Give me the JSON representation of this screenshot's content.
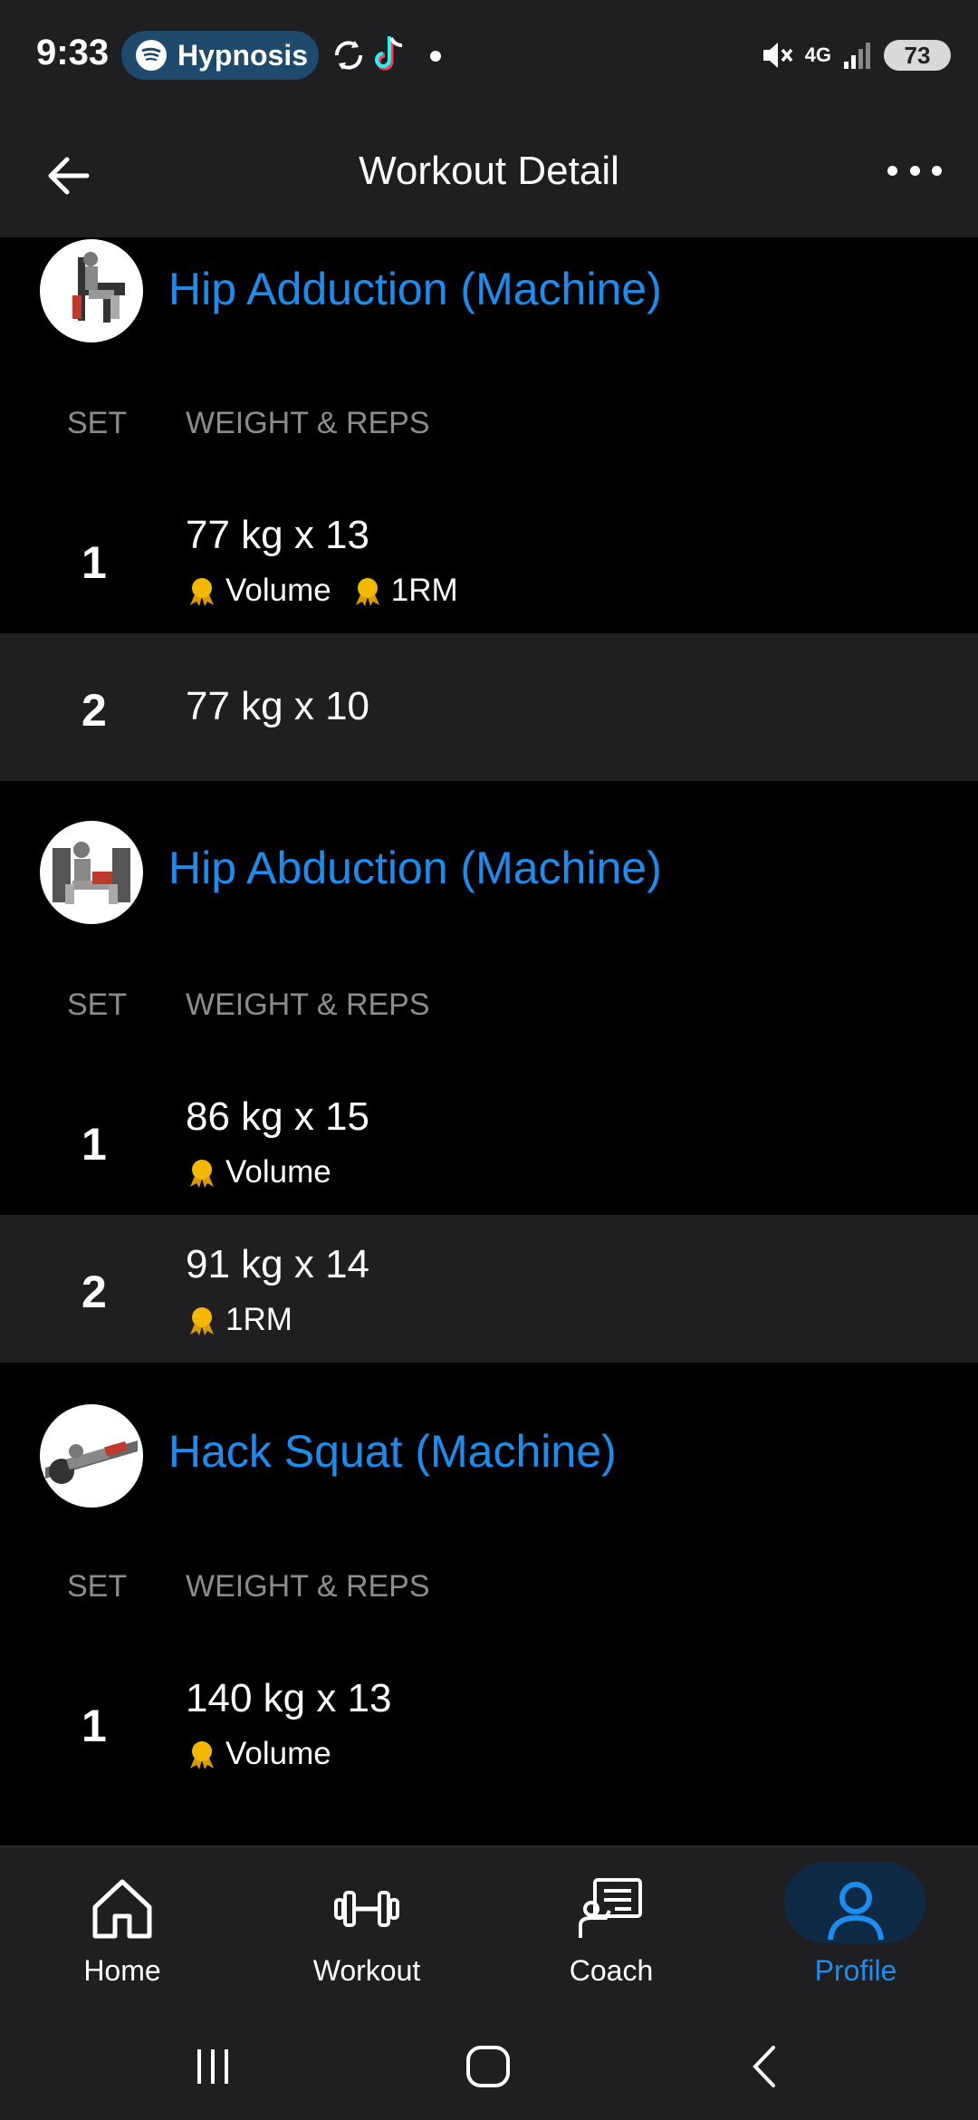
{
  "status_bar": {
    "time": "9:33",
    "media_label": "Hypnosis",
    "network": "4G",
    "battery": "73"
  },
  "header": {
    "title": "Workout Detail"
  },
  "columns": {
    "set": "SET",
    "weight_reps": "WEIGHT & REPS"
  },
  "exercises": [
    {
      "name": "Hip Adduction (Machine)",
      "sets": [
        {
          "num": "1",
          "value": "77 kg x 13",
          "records": [
            "Volume",
            "1RM"
          ]
        },
        {
          "num": "2",
          "value": "77 kg x 10",
          "records": []
        }
      ]
    },
    {
      "name": "Hip Abduction (Machine)",
      "sets": [
        {
          "num": "1",
          "value": "86 kg x 15",
          "records": [
            "Volume"
          ]
        },
        {
          "num": "2",
          "value": "91 kg x 14",
          "records": [
            "1RM"
          ]
        }
      ]
    },
    {
      "name": "Hack Squat (Machine)",
      "sets": [
        {
          "num": "1",
          "value": "140 kg x 13",
          "records": [
            "Volume"
          ]
        }
      ]
    }
  ],
  "bottom_nav": [
    {
      "label": "Home",
      "icon": "home-icon",
      "active": false
    },
    {
      "label": "Workout",
      "icon": "dumbbell-icon",
      "active": false
    },
    {
      "label": "Coach",
      "icon": "coach-icon",
      "active": false
    },
    {
      "label": "Profile",
      "icon": "profile-icon",
      "active": true
    }
  ],
  "colors": {
    "accent": "#1a8ef0",
    "medal": "#f5b800",
    "surface": "#1f1f21",
    "background": "#000000"
  }
}
